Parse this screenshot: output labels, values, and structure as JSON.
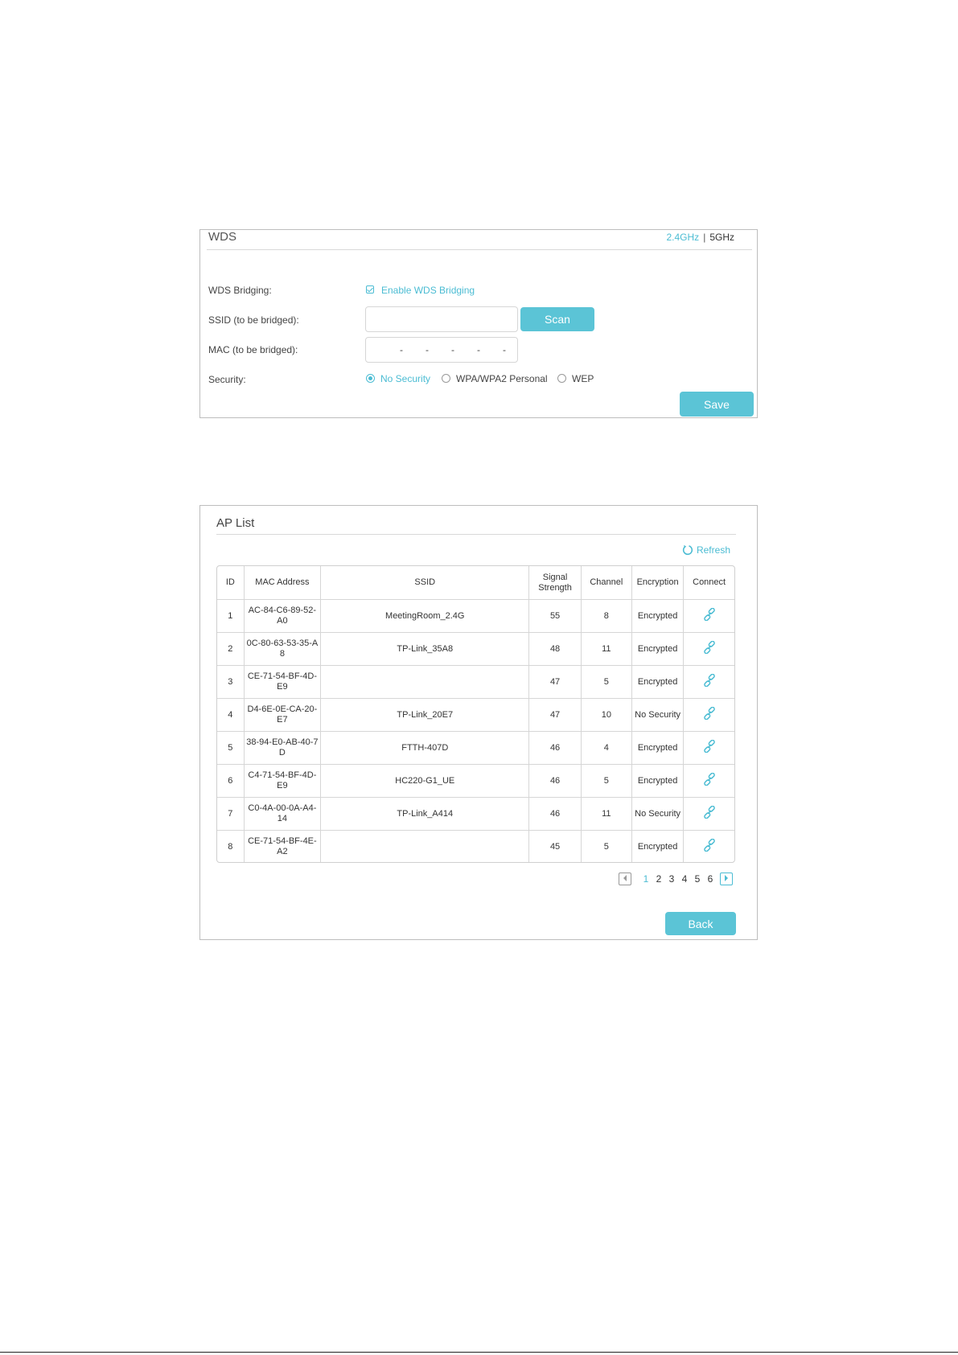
{
  "wds": {
    "title": "WDS",
    "band_24": "2.4GHz",
    "band_sep": "|",
    "band_5": "5GHz",
    "bridging_label": "WDS Bridging:",
    "enable_label": "Enable WDS Bridging",
    "ssid_label": "SSID (to be bridged):",
    "ssid_value": "",
    "scan_label": "Scan",
    "mac_label": "MAC (to be bridged):",
    "mac_separator": "-",
    "security_label": "Security:",
    "security_options": [
      "No Security",
      "WPA/WPA2 Personal",
      "WEP"
    ],
    "security_selected": "No Security",
    "save_label": "Save"
  },
  "ap_list": {
    "title": "AP List",
    "refresh_label": "Refresh",
    "headers": {
      "id": "ID",
      "mac": "MAC Address",
      "ssid": "SSID",
      "signal_line1": "Signal",
      "signal_line2": "Strength",
      "channel": "Channel",
      "encryption": "Encryption",
      "connect": "Connect"
    },
    "rows": [
      {
        "id": "1",
        "mac": "AC-84-C6-89-52-A0",
        "ssid": "MeetingRoom_2.4G",
        "signal": "55",
        "channel": "8",
        "encryption": "Encrypted"
      },
      {
        "id": "2",
        "mac": "0C-80-63-53-35-A8",
        "ssid": "TP-Link_35A8",
        "signal": "48",
        "channel": "11",
        "encryption": "Encrypted"
      },
      {
        "id": "3",
        "mac": "CE-71-54-BF-4D-E9",
        "ssid": "",
        "signal": "47",
        "channel": "5",
        "encryption": "Encrypted"
      },
      {
        "id": "4",
        "mac": "D4-6E-0E-CA-20-E7",
        "ssid": "TP-Link_20E7",
        "signal": "47",
        "channel": "10",
        "encryption": "No Security"
      },
      {
        "id": "5",
        "mac": "38-94-E0-AB-40-7D",
        "ssid": "FTTH-407D",
        "signal": "46",
        "channel": "4",
        "encryption": "Encrypted"
      },
      {
        "id": "6",
        "mac": "C4-71-54-BF-4D-E9",
        "ssid": "HC220-G1_UE",
        "signal": "46",
        "channel": "5",
        "encryption": "Encrypted"
      },
      {
        "id": "7",
        "mac": "C0-4A-00-0A-A4-14",
        "ssid": "TP-Link_A414",
        "signal": "46",
        "channel": "11",
        "encryption": "No Security"
      },
      {
        "id": "8",
        "mac": "CE-71-54-BF-4E-A2",
        "ssid": "",
        "signal": "45",
        "channel": "5",
        "encryption": "Encrypted"
      }
    ],
    "pages": [
      "1",
      "2",
      "3",
      "4",
      "5",
      "6"
    ],
    "current_page": "1",
    "back_label": "Back"
  },
  "colors": {
    "accent": "#4bbcd3",
    "button": "#5bc4d6"
  },
  "icons": [
    "checkbox-checked-icon",
    "refresh-icon",
    "link-icon",
    "chevron-left-icon",
    "chevron-right-icon"
  ]
}
